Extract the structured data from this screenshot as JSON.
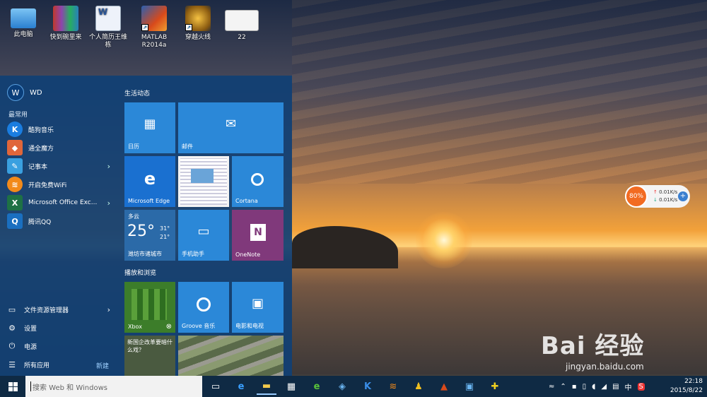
{
  "desktop": {
    "icons": [
      {
        "label": "此电脑",
        "icon": "computer-icon",
        "color": "#4aa3e8"
      },
      {
        "label": "快到碗里来",
        "icon": "winrar-icon",
        "color": "#7b3aa8"
      },
      {
        "label": "个人简历王维栋",
        "icon": "word-doc-icon",
        "color": "#e8eef8"
      },
      {
        "label": "MATLAB R2014a",
        "icon": "matlab-icon",
        "color": "#d84a1b"
      },
      {
        "label": "穿越火线",
        "icon": "crossfire-icon",
        "color": "#3a3a3a"
      },
      {
        "label": "22",
        "icon": "image-file-icon",
        "color": "#f0f0f0"
      }
    ]
  },
  "start_menu": {
    "user": {
      "initials": "W",
      "name": "WD"
    },
    "most_used_label": "最常用",
    "apps": [
      {
        "label": "酷狗音乐",
        "icon": "kugou-icon",
        "color": "#1a7de0",
        "glyph": "K"
      },
      {
        "label": "通全魔方",
        "icon": "mofang-icon",
        "color": "#e0663a",
        "glyph": "◆"
      },
      {
        "label": "记事本",
        "icon": "notepad-icon",
        "color": "#3aa0e0",
        "glyph": "✎",
        "arrow": "›"
      },
      {
        "label": "开启免费WiFi",
        "icon": "wifi-app-icon",
        "color": "#f28a1a",
        "glyph": "≋"
      },
      {
        "label": "Microsoft Office Exc...",
        "icon": "excel-icon",
        "color": "#1e7145",
        "glyph": "X",
        "arrow": "›"
      },
      {
        "label": "腾讯QQ",
        "icon": "qq-icon",
        "color": "#1a6fc0",
        "glyph": "Q"
      }
    ],
    "system": [
      {
        "label": "文件资源管理器",
        "icon": "folder-icon",
        "glyph": "▭",
        "arrow": "›"
      },
      {
        "label": "设置",
        "icon": "gear-icon",
        "glyph": "⚙"
      },
      {
        "label": "电源",
        "icon": "power-icon",
        "glyph": "⏻"
      },
      {
        "label": "所有应用",
        "icon": "list-icon",
        "glyph": "☰"
      }
    ],
    "new_label": "新建",
    "groups": {
      "life": "生活动态",
      "play": "播放和浏览"
    },
    "tiles": {
      "calendar": "日历",
      "mail": "邮件",
      "edge": "Microsoft Edge",
      "cortana": "Cortana",
      "weather": {
        "condition": "多云",
        "temp": "25°",
        "high": "31°",
        "low": "21°",
        "city": "潍坊市诸城市"
      },
      "phone": "手机助手",
      "onenote": "OneNote",
      "xbox": "Xbox",
      "groove": "Groove 音乐",
      "movies": "电影和电视",
      "news": "新国企改革要暗什么戏？"
    }
  },
  "taskbar": {
    "search_placeholder": "搜索 Web 和 Windows",
    "apps": [
      {
        "icon": "task-view-icon",
        "glyph": "▭",
        "color": "#ffffff"
      },
      {
        "icon": "edge-icon",
        "glyph": "e",
        "color": "#3aa0ff"
      },
      {
        "icon": "file-explorer-icon",
        "glyph": "▬",
        "color": "#f2c94c"
      },
      {
        "icon": "store-icon",
        "glyph": "▦",
        "color": "#ffffff"
      },
      {
        "icon": "360-browser-icon",
        "glyph": "e",
        "color": "#5ac43a"
      },
      {
        "icon": "network-app-icon",
        "glyph": "◈",
        "color": "#6ab4f0"
      },
      {
        "icon": "kugou-icon",
        "glyph": "K",
        "color": "#3a8ee8"
      },
      {
        "icon": "wifi-app-icon",
        "glyph": "≋",
        "color": "#f28a1a"
      },
      {
        "icon": "qq-icon",
        "glyph": "♟",
        "color": "#f0c020"
      },
      {
        "icon": "matlab-icon",
        "glyph": "▲",
        "color": "#d84a1b"
      },
      {
        "icon": "monitor-icon",
        "glyph": "▣",
        "color": "#6ab4f0"
      },
      {
        "icon": "game-icon",
        "glyph": "✚",
        "color": "#f0d020"
      }
    ],
    "tray": {
      "ime": "中",
      "time": "22:18",
      "date": "2015/8/22"
    }
  },
  "net_widget": {
    "percent": "80%",
    "up": "0.01K/s",
    "down": "0.01K/s"
  },
  "watermark": {
    "brand": "Bai 经验",
    "url": "jingyan.baidu.com"
  }
}
